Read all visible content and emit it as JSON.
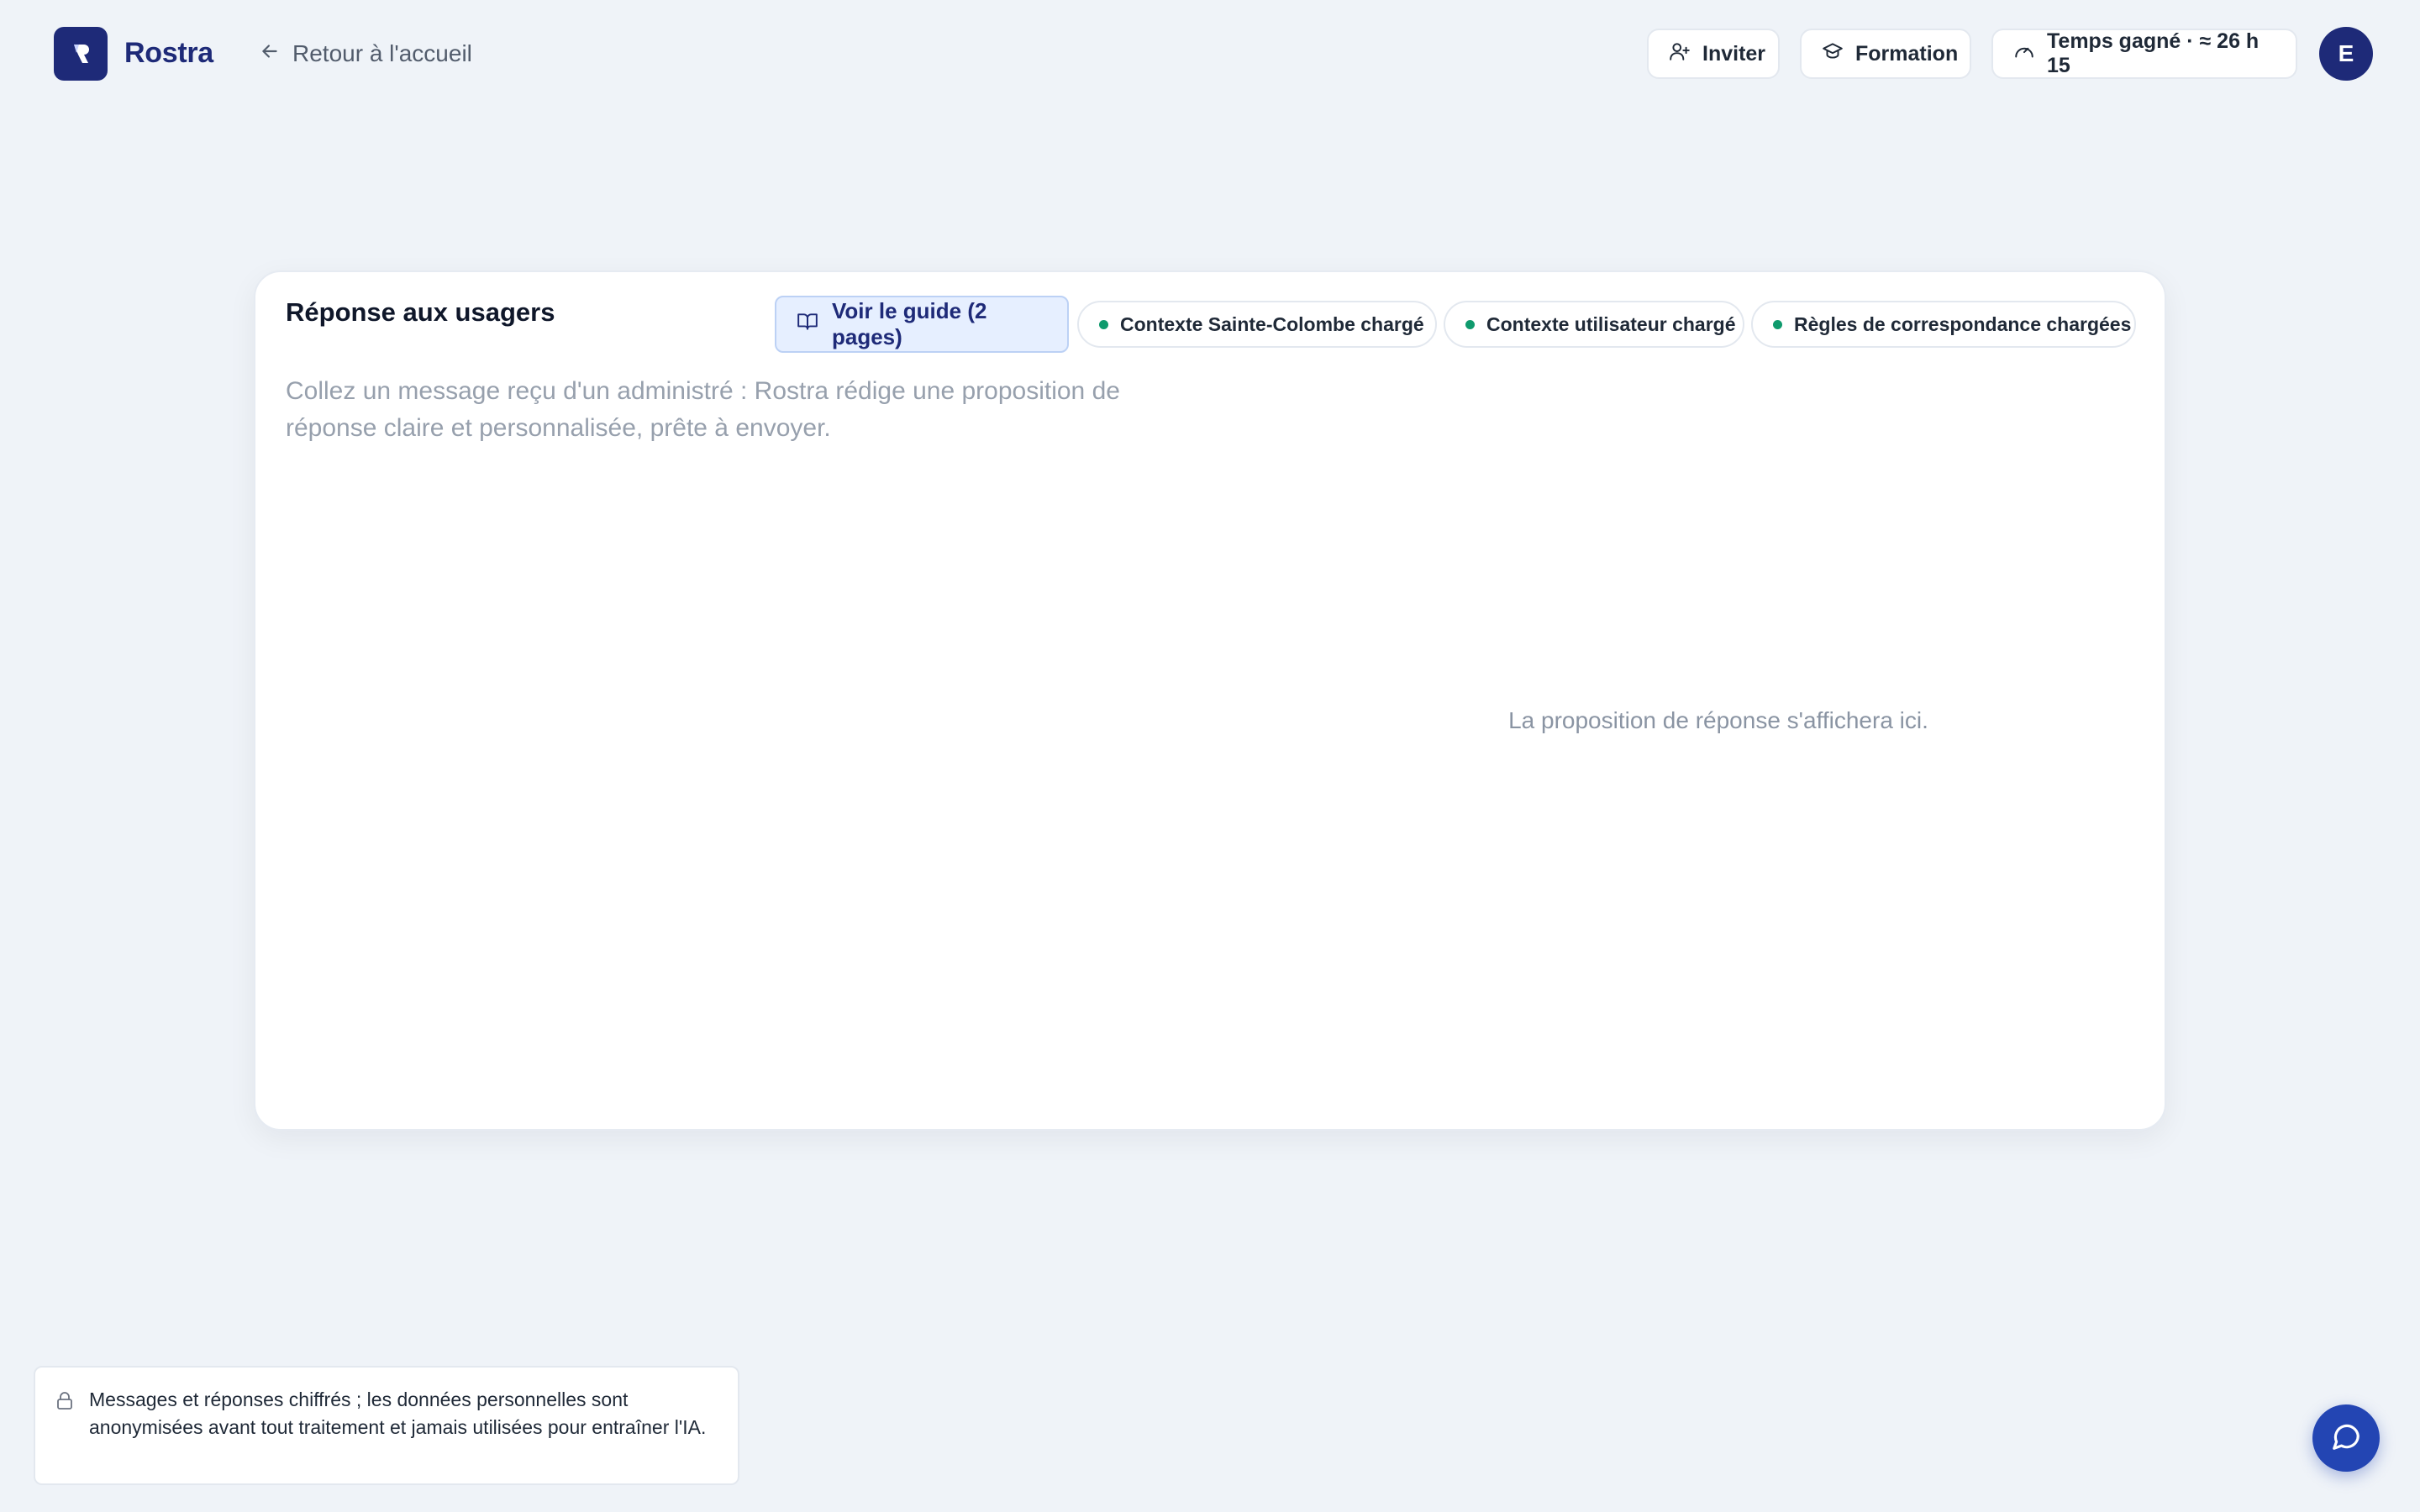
{
  "brand": {
    "name": "Rostra",
    "logo_icon": "rostra-logo-icon",
    "color": "#1e2a78"
  },
  "nav": {
    "back_label": "Retour à l'accueil",
    "back_icon": "arrow-left-icon"
  },
  "header_actions": {
    "invite_label": "Inviter",
    "invite_icon": "user-plus-icon",
    "training_label": "Formation",
    "training_icon": "graduation-cap-icon",
    "time_saved_label": "Temps gagné · ≈ 26 h 15",
    "time_saved_icon": "gauge-icon"
  },
  "user": {
    "avatar_initial": "E"
  },
  "card": {
    "title": "Réponse aux usagers",
    "guide_button_label": "Voir le guide (2 pages)",
    "guide_icon": "book-open-icon",
    "status_pills": [
      {
        "label": "Contexte Sainte-Colombe chargé",
        "status_color": "#0f9a6d"
      },
      {
        "label": "Contexte utilisateur chargé",
        "status_color": "#0f9a6d"
      },
      {
        "label": "Règles de correspondance chargées",
        "status_color": "#0f9a6d"
      }
    ],
    "input_placeholder": "Collez un message reçu d'un administré : Rostra rédige une proposition de réponse claire et personnalisée, prête à envoyer.",
    "input_value": "",
    "output_placeholder": "La proposition de réponse s'affichera ici."
  },
  "footer": {
    "privacy_notice": "Messages et réponses chiffrés ; les données personnelles sont anonymisées avant tout traitement et jamais utilisées pour entraîner l'IA.",
    "lock_icon": "lock-icon",
    "chat_icon": "message-circle-icon"
  },
  "colors": {
    "background": "#eff3f8",
    "accent": "#1e2a78",
    "fab": "#2345b3",
    "status_green": "#0f9a6d"
  }
}
